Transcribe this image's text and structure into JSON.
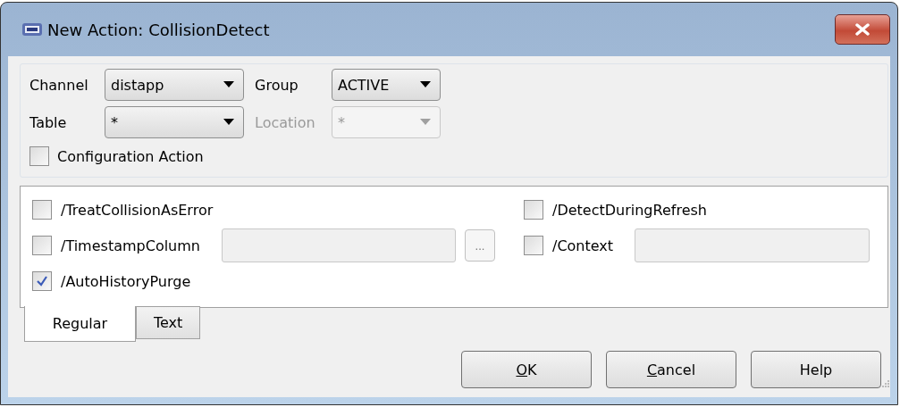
{
  "window": {
    "title": "New Action: CollisionDetect"
  },
  "scope": [
    {
      "label": "Channel",
      "value": "distapp",
      "disabled": false
    },
    {
      "label": "Group",
      "value": "ACTIVE",
      "disabled": false
    },
    {
      "label": "Table",
      "value": "*",
      "disabled": false
    },
    {
      "label": "Location",
      "value": "*",
      "disabled": true
    }
  ],
  "configuration_action": {
    "label": "Configuration Action",
    "checked": false
  },
  "options": [
    {
      "kind": "check",
      "label": "/TreatCollisionAsError",
      "checked": false
    },
    {
      "kind": "check",
      "label": "/DetectDuringRefresh",
      "checked": false
    },
    {
      "kind": "field_browse",
      "label": "/TimestampColumn",
      "checked": false,
      "browse": "..."
    },
    {
      "kind": "field",
      "label": "/Context",
      "checked": false
    },
    {
      "kind": "check",
      "label": "/AutoHistoryPurge",
      "checked": true
    }
  ],
  "tabs": [
    {
      "label": "Regular",
      "selected": true
    },
    {
      "label": "Text",
      "selected": false
    }
  ],
  "buttons": [
    {
      "label": "OK",
      "mnemonic": true
    },
    {
      "label": "Cancel",
      "mnemonic": true
    },
    {
      "label": "Help",
      "mnemonic": false
    }
  ]
}
